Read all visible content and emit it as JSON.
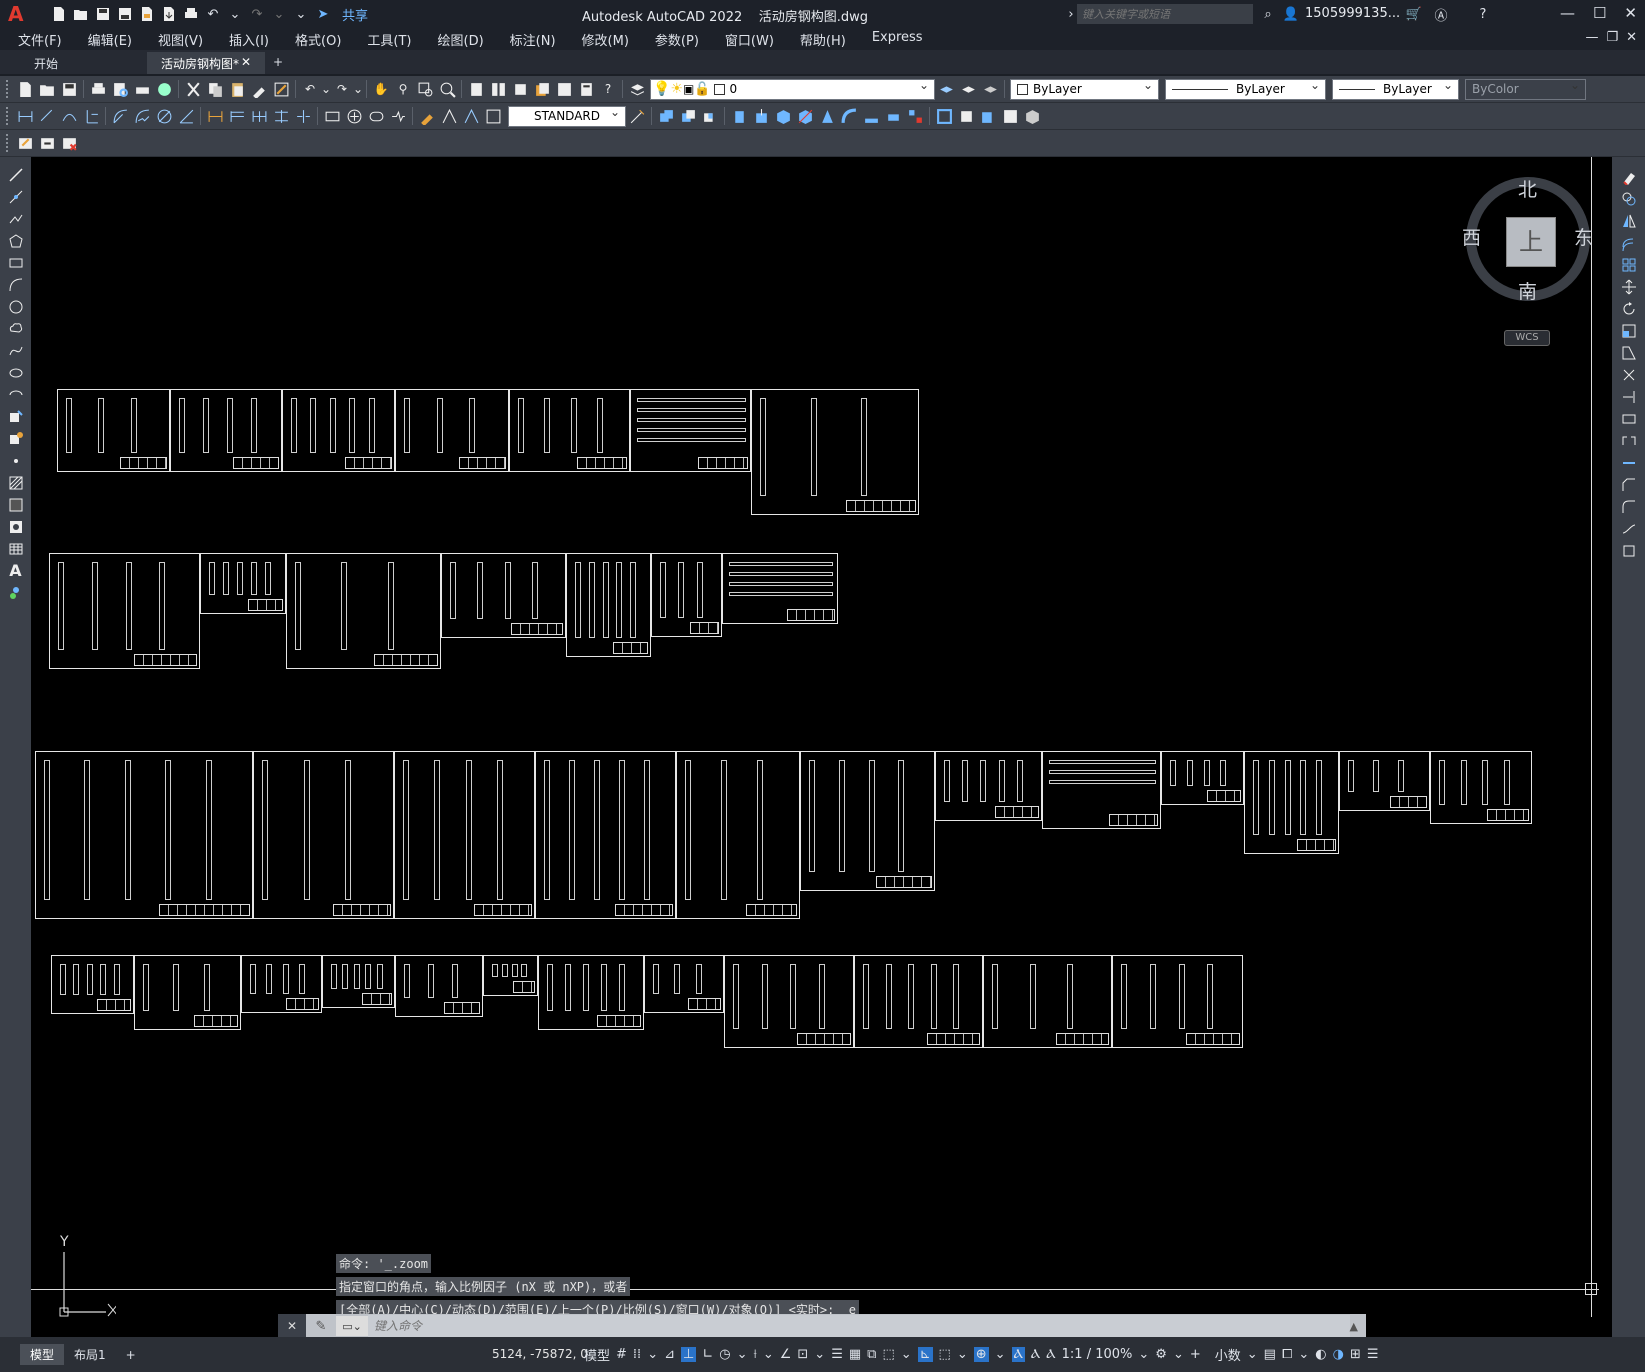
{
  "app": {
    "logo": "A",
    "title": "Autodesk AutoCAD 2022    活动房钢构图.dwg",
    "share_label": "共享",
    "search_placeholder": "键入关键字或短语",
    "user": "1505999135...",
    "accent_color": "#e03a2f"
  },
  "menu": {
    "items": [
      "文件(F)",
      "编辑(E)",
      "视图(V)",
      "插入(I)",
      "格式(O)",
      "工具(T)",
      "绘图(D)",
      "标注(N)",
      "修改(M)",
      "参数(P)",
      "窗口(W)",
      "帮助(H)",
      "Express"
    ]
  },
  "tabs": {
    "start": "开始",
    "active": "活动房钢构图*",
    "plus": "+"
  },
  "toolbar": {
    "layer_value": "0",
    "text_style": "STANDARD",
    "color": "ByLayer",
    "linetype": "ByLayer",
    "lineweight": "ByLayer",
    "plotstyle": "ByColor"
  },
  "viewcube": {
    "north": "北",
    "south": "南",
    "east": "东",
    "west": "西",
    "top": "上",
    "wcs": "WCS"
  },
  "ucs": {
    "y_label": "Y"
  },
  "command": {
    "history": [
      "命令: '_.zoom",
      "指定窗口的角点，输入比例因子 (nX 或 nXP)，或者",
      "[全部(A)/中心(C)/动态(D)/范围(E)/上一个(P)/比例(S)/窗口(W)/对象(O)] <实时>: _e"
    ],
    "placeholder": "键入命令"
  },
  "status": {
    "model_tab": "模型",
    "layout_tab": "布局1",
    "coords": "5124, -75872, 0",
    "model_label": "模型",
    "scale": "1:1 / 100%",
    "units": "小数"
  }
}
